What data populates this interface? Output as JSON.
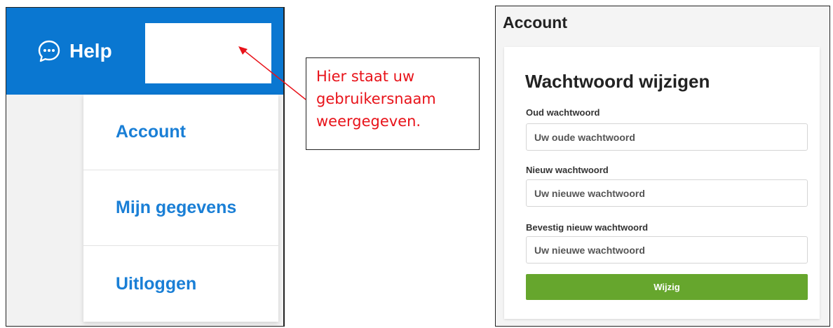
{
  "left": {
    "help_label": "Help",
    "help_icon": "chat-bubble-icon",
    "menu_items": [
      {
        "label": "Account"
      },
      {
        "label": "Mijn gegevens"
      },
      {
        "label": "Uitloggen"
      }
    ],
    "brand_color": "#0a77d1",
    "link_color": "#1a7fd6"
  },
  "annotation": {
    "lines": [
      "Hier staat uw",
      "gebruikersnaam",
      "weergegeven."
    ],
    "color": "#e8131a"
  },
  "right": {
    "title": "Account",
    "form_title": "Wachtwoord wijzigen",
    "fields": [
      {
        "label": "Oud wachtwoord",
        "placeholder": "Uw oude wachtwoord",
        "value": ""
      },
      {
        "label": "Nieuw wachtwoord",
        "placeholder": "Uw nieuwe wachtwoord",
        "value": ""
      },
      {
        "label": "Bevestig nieuw wachtwoord",
        "placeholder": "Uw nieuwe wachtwoord",
        "value": ""
      }
    ],
    "submit_label": "Wijzig",
    "button_color": "#66a62d"
  }
}
